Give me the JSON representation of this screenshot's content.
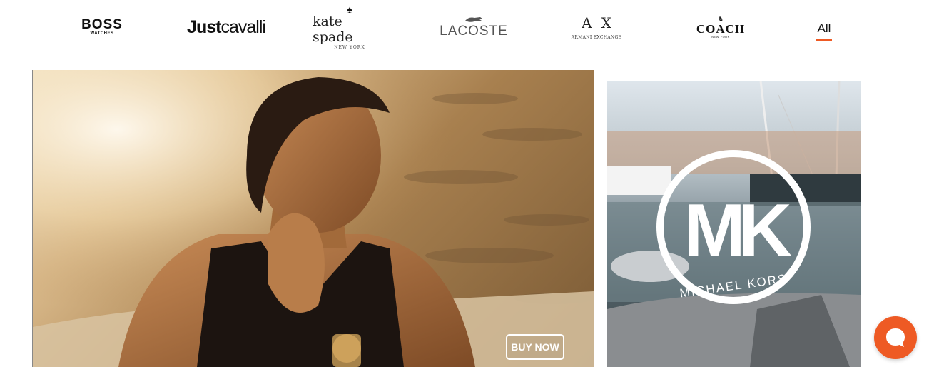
{
  "brands": {
    "boss": {
      "main": "BOSS",
      "sub": "WATCHES"
    },
    "just_cavalli": {
      "main_bold": "Just",
      "main_light": "cavalli"
    },
    "kate_spade": {
      "main": "kate spade",
      "sub": "NEW YORK"
    },
    "lacoste": {
      "main": "LACOSTE"
    },
    "armani_exchange": {
      "left": "A",
      "right": "X",
      "sub": "ARMANI EXCHANGE"
    },
    "coach": {
      "main": "COACH",
      "sub": "NEW YORK"
    }
  },
  "filter_tab": {
    "label": "All",
    "active_color": "#ee5a24"
  },
  "hero_banner": {
    "button_label": "BUY NOW"
  },
  "side_banner": {
    "logo_monogram": "MK",
    "logo_text": "MICHAEL KORS"
  },
  "chat": {
    "icon": "chat-bubble-icon",
    "color": "#ee5a24"
  }
}
